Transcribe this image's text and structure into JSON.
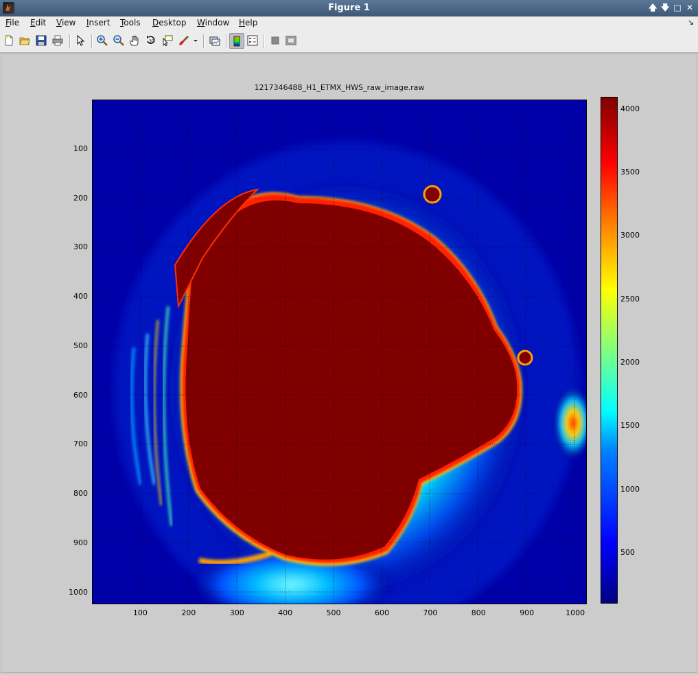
{
  "window": {
    "title": "Figure 1",
    "controls": [
      {
        "icon": "up-arrow-icon",
        "glyph": "🡅"
      },
      {
        "icon": "down-arrow-icon",
        "glyph": "🡇"
      },
      {
        "icon": "maximize-icon",
        "glyph": "□"
      },
      {
        "icon": "close-icon",
        "glyph": "✕"
      }
    ]
  },
  "menubar": {
    "items": [
      "File",
      "Edit",
      "View",
      "Insert",
      "Tools",
      "Desktop",
      "Window",
      "Help"
    ],
    "corner_glyph": "↘"
  },
  "toolbar": {
    "buttons": [
      {
        "icon": "new-figure-icon"
      },
      {
        "icon": "open-file-icon"
      },
      {
        "icon": "save-figure-icon"
      },
      {
        "icon": "print-figure-icon"
      },
      {
        "icon": "edit-plot-arrow-icon"
      },
      {
        "icon": "zoom-in-icon"
      },
      {
        "icon": "zoom-out-icon"
      },
      {
        "icon": "pan-hand-icon"
      },
      {
        "icon": "rotate-3d-icon"
      },
      {
        "icon": "data-cursor-icon"
      },
      {
        "icon": "brush-icon"
      },
      {
        "icon": "link-plot-icon"
      },
      {
        "icon": "colorbar-toggle-icon",
        "active": true
      },
      {
        "icon": "legend-toggle-icon"
      },
      {
        "icon": "hide-plot-tools-icon"
      },
      {
        "icon": "show-plot-tools-icon"
      }
    ]
  },
  "chart_data": {
    "type": "heatmap",
    "title": "1217346488_H1_ETMX_HWS_raw_image.raw",
    "xlabel": "",
    "ylabel": "",
    "xlim": [
      0,
      1024
    ],
    "ylim": [
      1024,
      0
    ],
    "x_ticks": [
      100,
      200,
      300,
      400,
      500,
      600,
      700,
      800,
      900,
      1000
    ],
    "y_ticks": [
      100,
      200,
      300,
      400,
      500,
      600,
      700,
      800,
      900,
      1000
    ],
    "grid": true,
    "colormap": "jet",
    "clim": [
      100,
      4095
    ],
    "colorbar_ticks": [
      500,
      1000,
      1500,
      2000,
      2500,
      3000,
      3500,
      4000
    ],
    "features": [
      {
        "name": "saturated core",
        "center_x": 520,
        "center_y": 600,
        "value": 4095
      },
      {
        "name": "lower-left glow",
        "center_x": 430,
        "center_y": 990,
        "value": 1500
      },
      {
        "name": "right edge spot",
        "center_x": 1000,
        "center_y": 650,
        "value": 3500
      }
    ]
  }
}
